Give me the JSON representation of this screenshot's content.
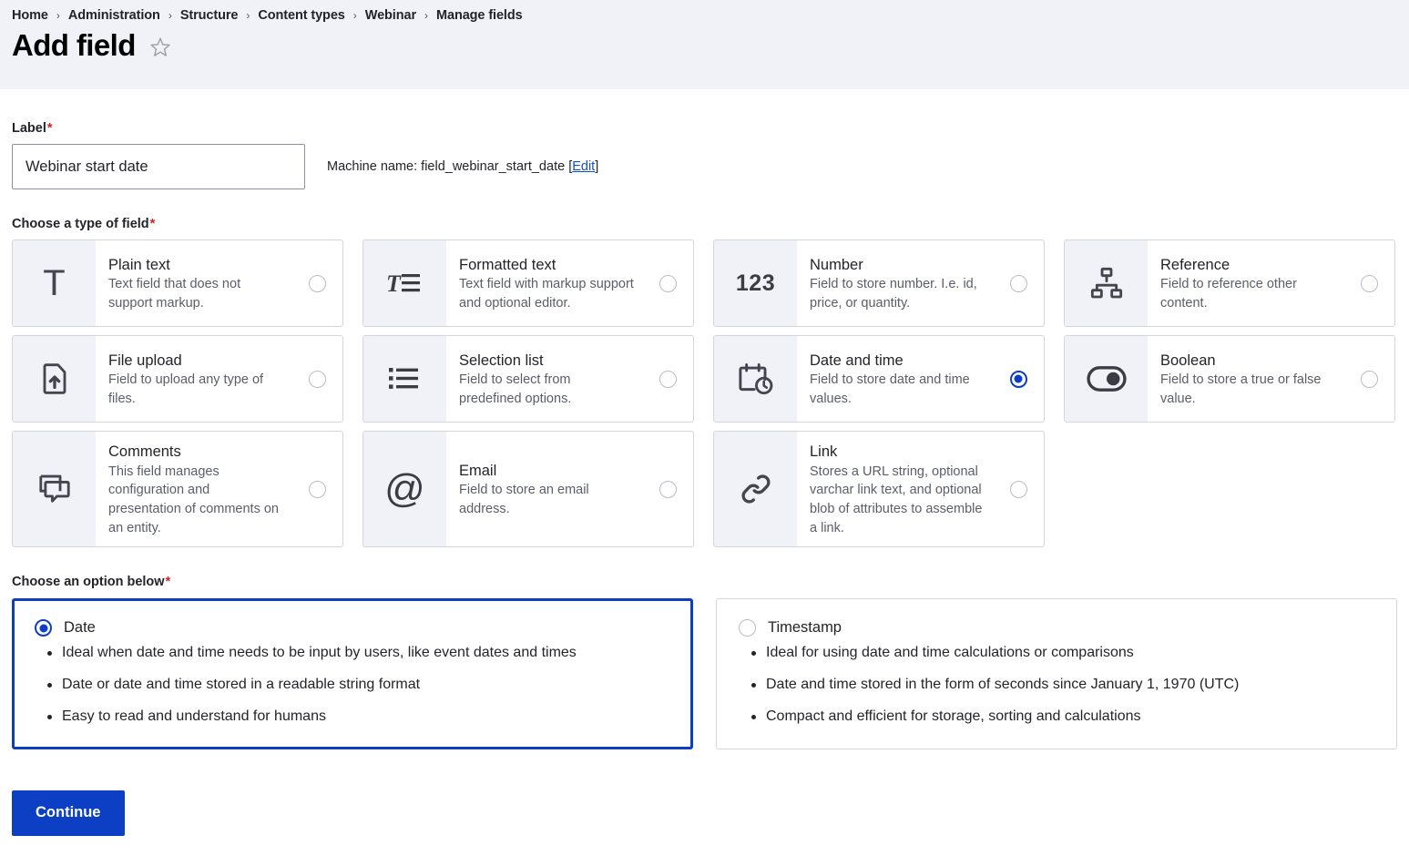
{
  "breadcrumb": {
    "items": [
      "Home",
      "Administration",
      "Structure",
      "Content types",
      "Webinar",
      "Manage fields"
    ],
    "separator": "›"
  },
  "header": {
    "title": "Add field",
    "star_icon": "star-outline-icon"
  },
  "label_field": {
    "label": "Label",
    "required_marker": "*",
    "value": "Webinar start date",
    "placeholder": "",
    "machine_name_prefix": "Machine name: field_webinar_start_date ",
    "machine_name_edit_open": "[",
    "machine_name_edit": "Edit",
    "machine_name_edit_close": "]"
  },
  "field_type_section": {
    "label": "Choose a type of field",
    "required_marker": "*",
    "cards": [
      {
        "title": "Plain text",
        "description": "Text field that does not support markup.",
        "icon": "plain-text-icon",
        "selected": false
      },
      {
        "title": "Formatted text",
        "description": "Text field with markup support and optional editor.",
        "icon": "formatted-text-icon",
        "selected": false
      },
      {
        "title": "Number",
        "description": "Field to store number. I.e. id, price, or quantity.",
        "icon": "number-123-icon",
        "selected": false
      },
      {
        "title": "Reference",
        "description": "Field to reference other content.",
        "icon": "reference-sitemap-icon",
        "selected": false
      },
      {
        "title": "File upload",
        "description": "Field to upload any type of files.",
        "icon": "file-upload-icon",
        "selected": false
      },
      {
        "title": "Selection list",
        "description": "Field to select from predefined options.",
        "icon": "selection-list-icon",
        "selected": false
      },
      {
        "title": "Date and time",
        "description": "Field to store date and time values.",
        "icon": "calendar-clock-icon",
        "selected": true
      },
      {
        "title": "Boolean",
        "description": "Field to store a true or false value.",
        "icon": "toggle-switch-icon",
        "selected": false
      },
      {
        "title": "Comments",
        "description": "This field manages configuration and presentation of comments on an entity.",
        "icon": "comments-bubbles-icon",
        "selected": false
      },
      {
        "title": "Email",
        "description": "Field to store an email address.",
        "icon": "at-sign-icon",
        "selected": false
      },
      {
        "title": "Link",
        "description": "Stores a URL string, optional varchar link text, and optional blob of attributes to assemble a link.",
        "icon": "chain-link-icon",
        "selected": false
      }
    ]
  },
  "option_section": {
    "label": "Choose an option below",
    "required_marker": "*",
    "options": [
      {
        "title": "Date",
        "selected": true,
        "bullets": [
          "Ideal when date and time needs to be input by users, like event dates and times",
          "Date or date and time stored in a readable string format",
          "Easy to read and understand for humans"
        ]
      },
      {
        "title": "Timestamp",
        "selected": false,
        "bullets": [
          "Ideal for using date and time calculations or comparisons",
          "Date and time stored in the form of seconds since January 1, 1970 (UTC)",
          "Compact and efficient for storage, sorting and calculations"
        ]
      }
    ]
  },
  "footer": {
    "continue_label": "Continue"
  },
  "colors": {
    "accent_blue": "#0c3fc4",
    "link_blue": "#1152ca",
    "required_red": "#d72222",
    "header_band": "#f1f2f7",
    "card_border": "#d4d6dd",
    "icon_bg": "#f1f2f7"
  }
}
